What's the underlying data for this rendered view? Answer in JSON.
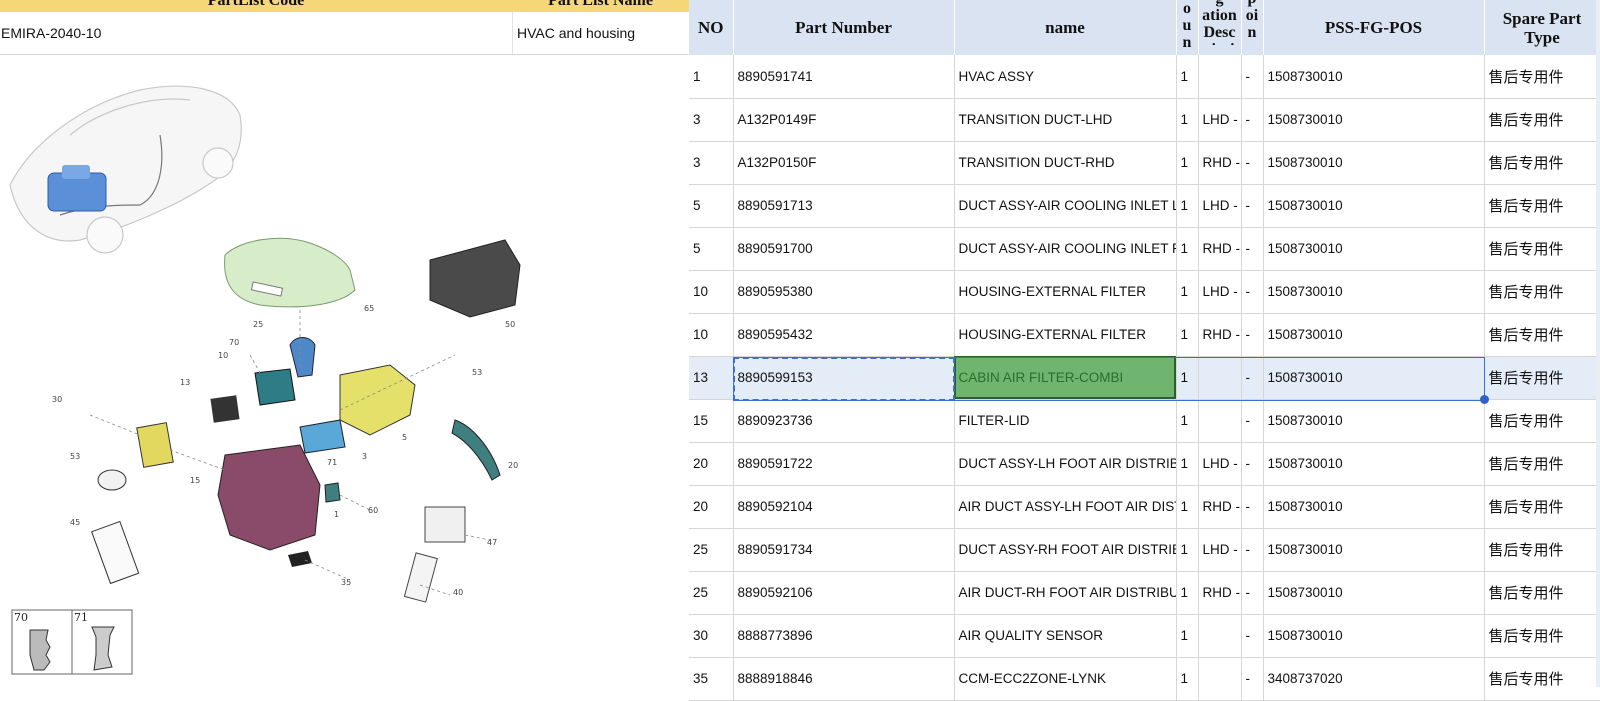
{
  "left_header": {
    "code_title": "PartList Code",
    "name_title": "Part List Name",
    "code_value": "EMIRA-2040-10",
    "name_value": "HVAC and housing"
  },
  "diagram": {
    "callouts": [
      "65",
      "50",
      "25",
      "70",
      "10",
      "53",
      "13",
      "30",
      "5",
      "71",
      "3",
      "20",
      "15",
      "53",
      "45",
      "1",
      "60",
      "47",
      "35",
      "40"
    ],
    "insets": [
      "70",
      "71"
    ]
  },
  "table": {
    "columns": [
      "NO",
      "Part Number",
      "name",
      "o\nu\nn",
      "g\nation\nDesc\nripti",
      "p\noi\nn\nt",
      "PSS-FG-POS",
      "Spare Part\nType"
    ],
    "rows": [
      {
        "no": "1",
        "part": "8890591741",
        "name": "HVAC ASSY",
        "qty": "1",
        "desc": "",
        "pt": "-",
        "pos": "1508730010",
        "type": "售后专用件"
      },
      {
        "no": "3",
        "part": "A132P0149F",
        "name": "TRANSITION DUCT-LHD",
        "qty": "1",
        "desc": "LHD - l",
        "pt": "-",
        "pos": "1508730010",
        "type": "售后专用件"
      },
      {
        "no": "3",
        "part": "A132P0150F",
        "name": "TRANSITION DUCT-RHD",
        "qty": "1",
        "desc": "RHD -",
        "pt": "-",
        "pos": "1508730010",
        "type": "售后专用件"
      },
      {
        "no": "5",
        "part": "8890591713",
        "name": "DUCT ASSY-AIR COOLING INLET LH",
        "qty": "1",
        "desc": "LHD - l",
        "pt": "-",
        "pos": "1508730010",
        "type": "售后专用件"
      },
      {
        "no": "5",
        "part": "8890591700",
        "name": "DUCT ASSY-AIR COOLING INLET RH",
        "qty": "1",
        "desc": "RHD -",
        "pt": "-",
        "pos": "1508730010",
        "type": "售后专用件"
      },
      {
        "no": "10",
        "part": "8890595380",
        "name": "HOUSING-EXTERNAL FILTER",
        "qty": "1",
        "desc": "LHD - l",
        "pt": "-",
        "pos": "1508730010",
        "type": "售后专用件"
      },
      {
        "no": "10",
        "part": "8890595432",
        "name": "HOUSING-EXTERNAL FILTER",
        "qty": "1",
        "desc": "RHD -",
        "pt": "-",
        "pos": "1508730010",
        "type": "售后专用件"
      },
      {
        "no": "13",
        "part": "8890599153",
        "name": "CABIN AIR FILTER-COMBI",
        "qty": "1",
        "desc": "",
        "pt": "-",
        "pos": "1508730010",
        "type": "售后专用件"
      },
      {
        "no": "15",
        "part": "8890923736",
        "name": "FILTER-LID",
        "qty": "1",
        "desc": "",
        "pt": "-",
        "pos": "1508730010",
        "type": "售后专用件"
      },
      {
        "no": "20",
        "part": "8890591722",
        "name": "DUCT ASSY-LH FOOT AIR DISTRIBUT",
        "qty": "1",
        "desc": "LHD - l",
        "pt": "-",
        "pos": "1508730010",
        "type": "售后专用件"
      },
      {
        "no": "20",
        "part": "8890592104",
        "name": "AIR DUCT ASSY-LH FOOT AIR DISTR",
        "qty": "1",
        "desc": "RHD -",
        "pt": "-",
        "pos": "1508730010",
        "type": "售后专用件"
      },
      {
        "no": "25",
        "part": "8890591734",
        "name": "DUCT ASSY-RH FOOT AIR DISTRIBUT",
        "qty": "1",
        "desc": "LHD - l",
        "pt": "-",
        "pos": "1508730010",
        "type": "售后专用件"
      },
      {
        "no": "25",
        "part": "8890592106",
        "name": "AIR DUCT-RH FOOT AIR DISTRIBUTO",
        "qty": "1",
        "desc": "RHD -",
        "pt": "-",
        "pos": "1508730010",
        "type": "售后专用件"
      },
      {
        "no": "30",
        "part": "8888773896",
        "name": "AIR QUALITY SENSOR",
        "qty": "1",
        "desc": "",
        "pt": "-",
        "pos": "1508730010",
        "type": "售后专用件"
      },
      {
        "no": "35",
        "part": "8888918846",
        "name": "CCM-ECC2ZONE-LYNK",
        "qty": "1",
        "desc": "",
        "pt": "-",
        "pos": "3408737020",
        "type": "售后专用件"
      }
    ]
  },
  "colors": {
    "header_yellow": "#f5d77a",
    "header_blue": "#d9e3f1",
    "selection": "#3a6ed0",
    "active_fill": "#6fb56f"
  }
}
